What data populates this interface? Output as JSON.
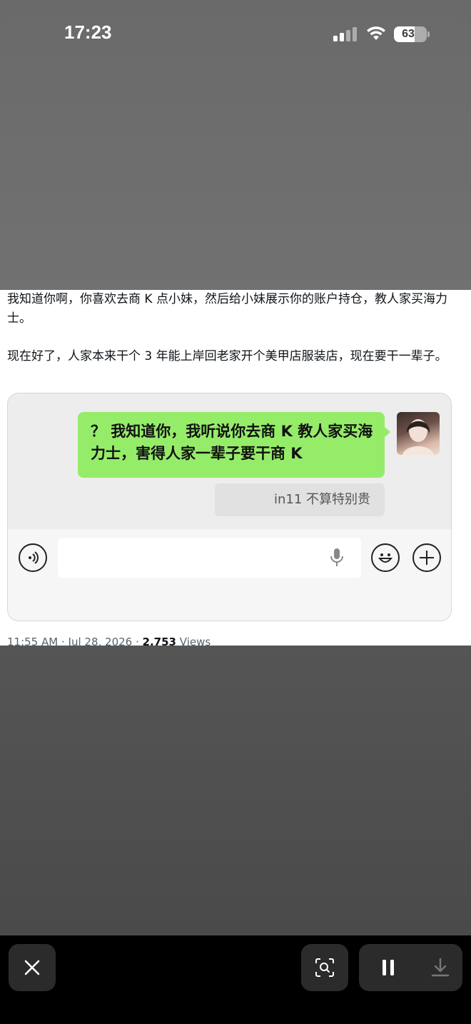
{
  "status_bar": {
    "time": "17:23",
    "battery_percent": "63",
    "battery_level": 0.63
  },
  "post": {
    "paragraph_1": "我知道你啊，你喜欢去商 K 点小妹，然后给小妹展示你的账户持仓，教人家买海力士。",
    "paragraph_2": "现在好了，人家本来干个 3 年能上岸回老家开个美甲店服装店，现在要干一辈子。",
    "chat_image": {
      "message": "？ 我知道你，我听说你去商 K 教人家买海力士，害得人家一辈子要干商 K",
      "quoted_reply": "in11 不算特别贵"
    },
    "meta": {
      "time": "11:55 AM",
      "date": "Jul 28, 2026",
      "views_count": "2,753",
      "views_label": "Views"
    }
  },
  "colors": {
    "bubble_green": "#95ec69",
    "dim_overlay": "#5c5c5c",
    "toolbar_bg": "#000000"
  },
  "icons": {
    "close": "close-icon",
    "lens": "visual-lookup-icon",
    "pause": "pause-icon",
    "download": "download-icon"
  }
}
